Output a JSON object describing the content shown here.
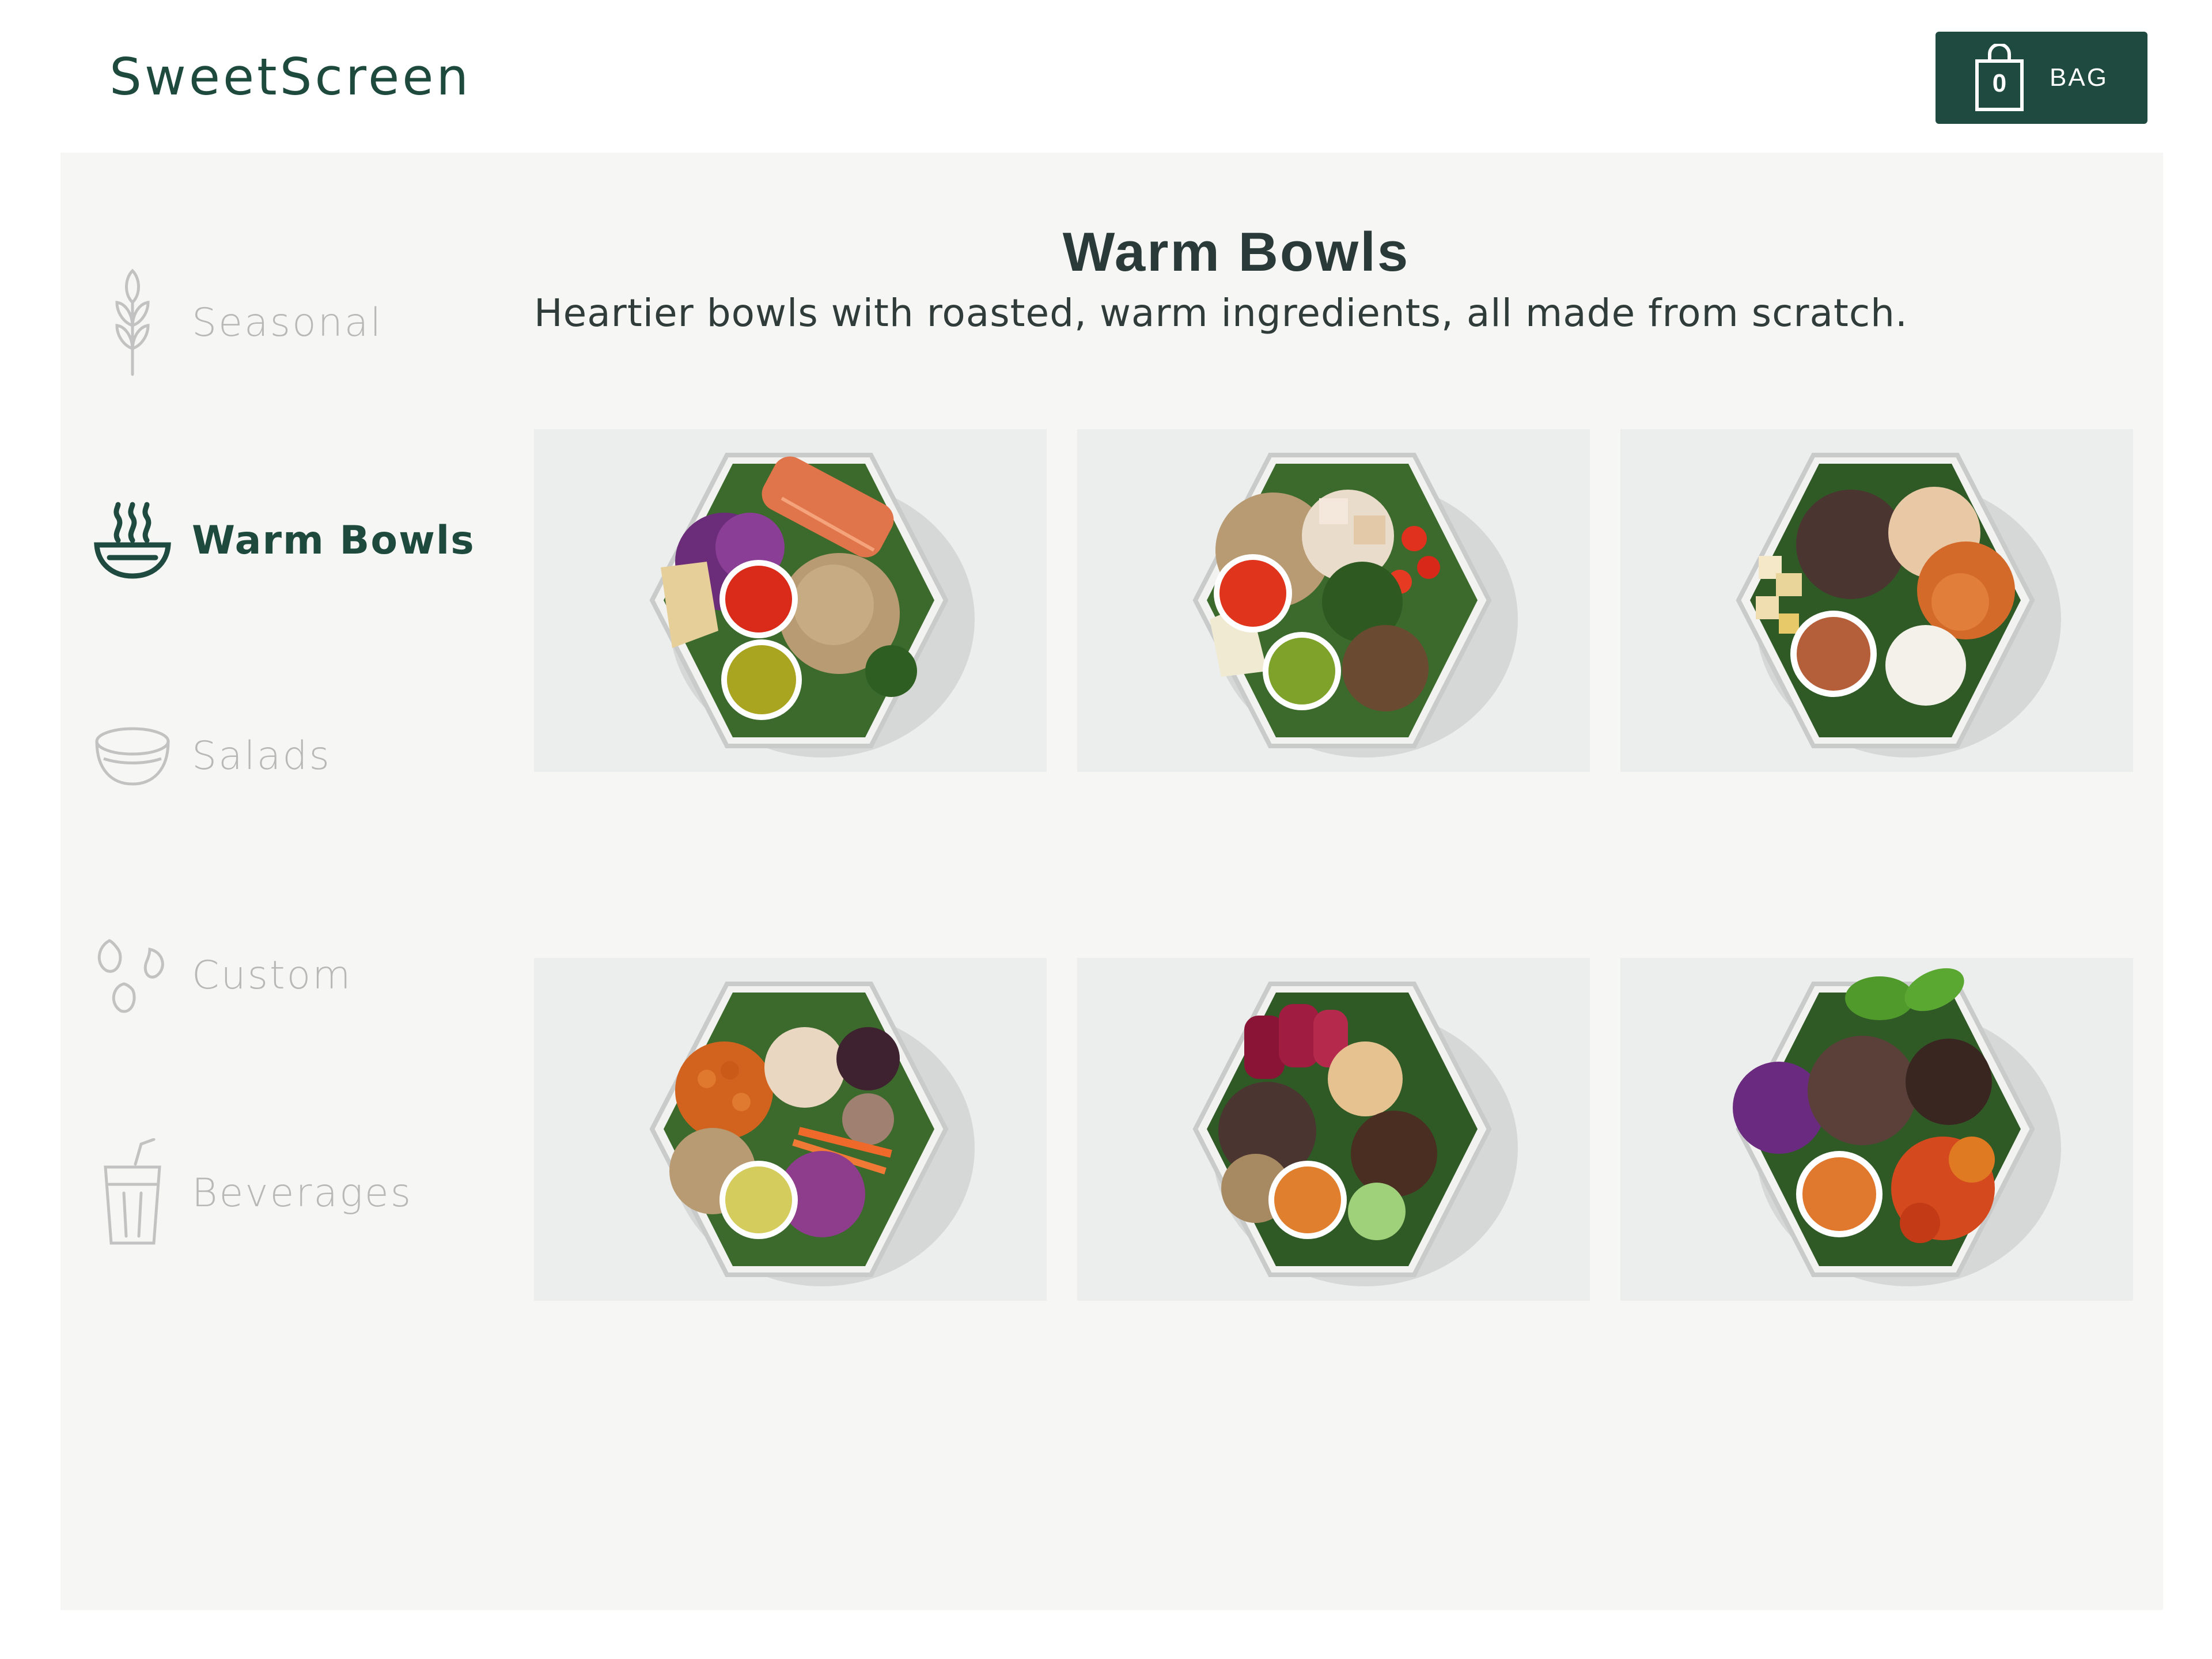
{
  "app": {
    "logo": "SweetScreen"
  },
  "bag": {
    "count": "0",
    "label": "BAG"
  },
  "sidebar": {
    "items": [
      {
        "label": "Seasonal",
        "icon": "wheat-icon",
        "active": false
      },
      {
        "label": "Warm Bowls",
        "icon": "steaming-bowl-icon",
        "active": true
      },
      {
        "label": "Salads",
        "icon": "salad-bowl-icon",
        "active": false
      },
      {
        "label": "Custom",
        "icon": "seeds-icon",
        "active": false
      },
      {
        "label": "Beverages",
        "icon": "drink-cup-icon",
        "active": false
      }
    ]
  },
  "section": {
    "title": "Warm Bowls",
    "subtitle": "Heartier bowls with roasted, warm ingredients, all made from scratch."
  },
  "colors": {
    "brand_green": "#1f4a3f",
    "inactive_text": "#b8b8b8",
    "panel_background": "#f6f6f4",
    "tile_background": "#eceeed"
  },
  "menu_items": [
    {
      "image": "bowl-salmon-photo"
    },
    {
      "image": "bowl-chicken-tomato-photo"
    },
    {
      "image": "bowl-apple-sweet-potato-photo"
    },
    {
      "image": "bowl-chickpea-photo"
    },
    {
      "image": "bowl-beet-mushroom-photo"
    },
    {
      "image": "bowl-basil-roasted-veg-photo"
    }
  ]
}
